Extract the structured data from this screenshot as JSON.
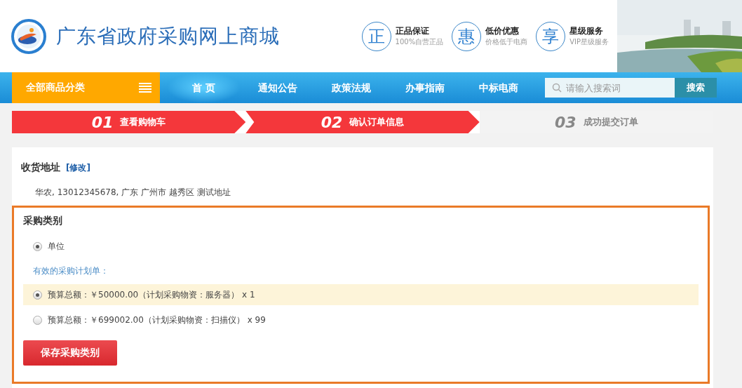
{
  "header": {
    "site_title": "广东省政府采购网上商城",
    "features": [
      {
        "icon": "正",
        "title": "正品保证",
        "subtitle": "100%自营正品"
      },
      {
        "icon": "惠",
        "title": "低价优惠",
        "subtitle": "价格低于电商"
      },
      {
        "icon": "享",
        "title": "星级服务",
        "subtitle": "VIP星级服务"
      }
    ]
  },
  "nav": {
    "category_menu": "全部商品分类",
    "items": [
      {
        "label": "首 页",
        "selected": true
      },
      {
        "label": "通知公告",
        "selected": false
      },
      {
        "label": "政策法规",
        "selected": false
      },
      {
        "label": "办事指南",
        "selected": false
      },
      {
        "label": "中标电商",
        "selected": false
      }
    ],
    "search": {
      "placeholder": "请输入搜索词",
      "button": "搜索"
    }
  },
  "steps": [
    {
      "number": "01",
      "label": "查看购物车",
      "active": true
    },
    {
      "number": "02",
      "label": "确认订单信息",
      "active": true
    },
    {
      "number": "03",
      "label": "成功提交订单",
      "active": false
    }
  ],
  "address": {
    "title": "收货地址",
    "edit_link": "[修改]",
    "text": "华农, 13012345678, 广东 广州市 越秀区 测试地址"
  },
  "purchase_type": {
    "title": "采购类别",
    "options": [
      {
        "label": "单位",
        "selected": true
      }
    ],
    "plans_label": "有效的采购计划单：",
    "plans": [
      {
        "label": "预算总额：￥50000.00（计划采购物资：服务器） x 1",
        "selected": true
      },
      {
        "label": "预算总额：￥699002.00（计划采购物资：扫描仪） x 99",
        "selected": false
      }
    ],
    "save_button": "保存采购类别"
  }
}
